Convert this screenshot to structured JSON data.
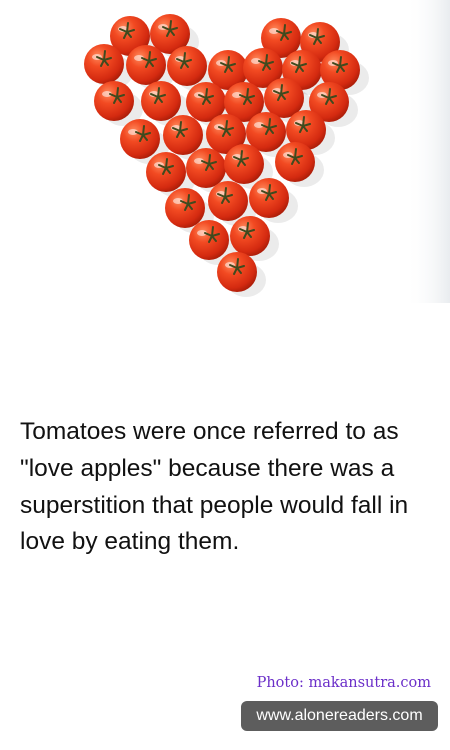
{
  "photo": {
    "subject": "tomatoes arranged in a heart shape"
  },
  "fact": {
    "text": "Tomatoes were once referred to as \"love apples\" because there was a superstition that people would fall in love by eating them."
  },
  "credit": {
    "text": "Photo: makansutra.com"
  },
  "site": {
    "text": "www.alonereaders.com"
  },
  "colors": {
    "tomato": "#e8361a",
    "credit": "#6b2fc9",
    "badge": "#5d5d5d"
  }
}
